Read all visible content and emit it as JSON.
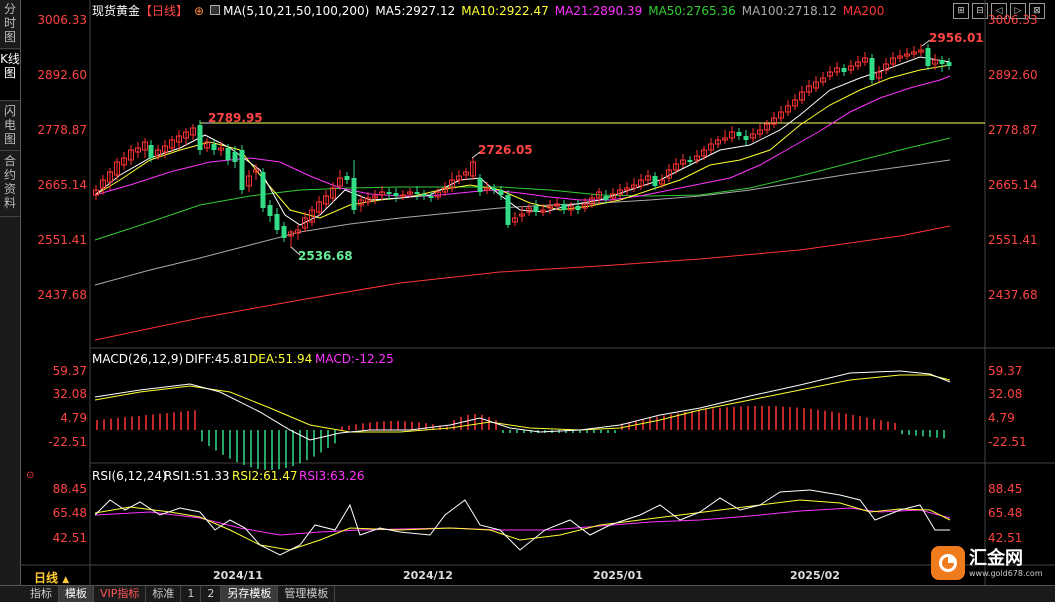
{
  "sidebar": {
    "tabs": [
      {
        "label": "分时图",
        "active": false
      },
      {
        "label": "K线图",
        "active": true
      },
      {
        "label": "闪电图",
        "active": false
      },
      {
        "label": "合约资料",
        "active": false
      }
    ]
  },
  "header": {
    "symbol": "现货黄金",
    "period_tag": "【日线】",
    "ma_params": "MA(5,10,21,50,100,200)",
    "ma5": "MA5:2927.12",
    "ma10": "MA10:2922.47",
    "ma21": "MA21:2890.39",
    "ma50": "MA50:2765.36",
    "ma100": "MA100:2718.12",
    "ma200": "MA200",
    "tools": [
      "⊞",
      "⊟",
      "◁",
      "▷",
      "⊠"
    ]
  },
  "price_axis": {
    "ticks": [
      "3006.33",
      "2892.60",
      "2778.87",
      "2665.14",
      "2551.41",
      "2437.68"
    ]
  },
  "annotations": {
    "high_nov": "2789.95",
    "low_nov": "2536.68",
    "high_dec": "2726.05",
    "high_feb": "2956.01"
  },
  "macd": {
    "label": "MACD(26,12,9)",
    "diff": "DIFF:45.81",
    "dea": "DEA:51.94",
    "macd": "MACD:-12.25",
    "ticks": [
      "59.37",
      "32.08",
      "4.79",
      "-22.51"
    ]
  },
  "rsi": {
    "label": "RSI(6,12,24)",
    "rsi1": "RSI1:51.33",
    "rsi2": "RSI2:61.47",
    "rsi3": "RSI3:63.26",
    "ticks": [
      "88.45",
      "65.48",
      "42.51"
    ]
  },
  "date_axis": [
    "2024/11",
    "2024/12",
    "2025/01",
    "2025/02"
  ],
  "period_label": "日线",
  "bottom_tabs": [
    {
      "label": "指标",
      "active": false
    },
    {
      "label": "模板",
      "active": true
    },
    {
      "label": "VIP指标",
      "active": false
    },
    {
      "label": "标准",
      "active": false
    },
    {
      "label": "1",
      "active": false
    },
    {
      "label": "2",
      "active": false
    },
    {
      "label": "另存模板",
      "active": true
    },
    {
      "label": "管理模板",
      "active": false
    }
  ],
  "logo": {
    "name": "汇金网",
    "url": "www.gold678.com"
  },
  "colors": {
    "ma5": "#ffffff",
    "ma10": "#ffff33",
    "ma21": "#ff33ff",
    "ma50": "#33cc33",
    "ma100": "#aaaaaa",
    "ma200": "#ff3333",
    "up": "#ff3333",
    "down": "#33dd88",
    "axis_text": "#ff4444"
  }
}
